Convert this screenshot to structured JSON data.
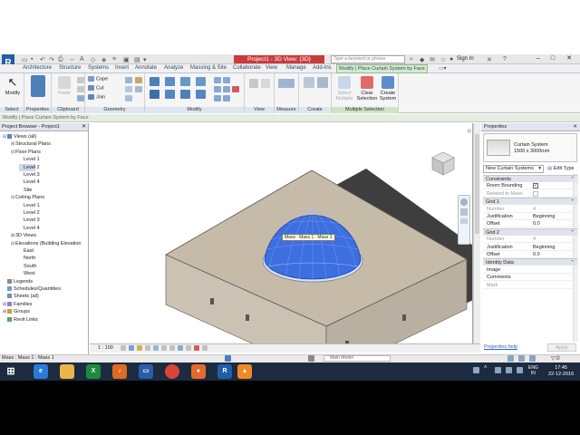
{
  "app": {
    "window_title": "Project1 - 3D View: {3D}",
    "search_placeholder": "Type a keyword or phrase",
    "sign_in": "Sign In"
  },
  "tabs": [
    "Architecture",
    "Structure",
    "Systems",
    "Insert",
    "Annotate",
    "Analyze",
    "Massing & Site",
    "Collaborate",
    "View",
    "Manage",
    "Add-Ins"
  ],
  "active_tab": "Modify | Place Curtain System by Face",
  "ribbon": {
    "panels": {
      "select": "Select",
      "properties": "Properties",
      "clipboard": "Clipboard",
      "geometry": "Geometry",
      "modify": "Modify",
      "view": "View",
      "measure": "Measure",
      "create": "Create",
      "multiple_selection": "Multiple Selection"
    },
    "buttons": {
      "modify": "Modify",
      "paste": "Paste",
      "cope": "Cope",
      "cut": "Cut",
      "join": "Join",
      "select_multiple": "Select Multiple",
      "clear_selection": "Clear Selection",
      "create_system": "Create System"
    }
  },
  "options_bar": "Modify | Place Curtain System by Face",
  "project_browser": {
    "title": "Project Browser - Project1",
    "items": [
      {
        "label": "Views (all)",
        "level": 0,
        "tog": "⊟",
        "icon": "views"
      },
      {
        "label": "Structural Plans",
        "level": 1,
        "tog": "⊞",
        "icon": ""
      },
      {
        "label": "Floor Plans",
        "level": 1,
        "tog": "⊟",
        "icon": ""
      },
      {
        "label": "Level 1",
        "level": 2,
        "tog": "",
        "icon": ""
      },
      {
        "label": "Level 2",
        "level": 2,
        "tog": "",
        "icon": "",
        "selected": true
      },
      {
        "label": "Level 3",
        "level": 2,
        "tog": "",
        "icon": ""
      },
      {
        "label": "Level 4",
        "level": 2,
        "tog": "",
        "icon": ""
      },
      {
        "label": "Site",
        "level": 2,
        "tog": "",
        "icon": ""
      },
      {
        "label": "Ceiling Plans",
        "level": 1,
        "tog": "⊟",
        "icon": ""
      },
      {
        "label": "Level 1",
        "level": 2,
        "tog": "",
        "icon": ""
      },
      {
        "label": "Level 2",
        "level": 2,
        "tog": "",
        "icon": ""
      },
      {
        "label": "Level 3",
        "level": 2,
        "tog": "",
        "icon": ""
      },
      {
        "label": "Level 4",
        "level": 2,
        "tog": "",
        "icon": ""
      },
      {
        "label": "3D Views",
        "level": 1,
        "tog": "⊞",
        "icon": ""
      },
      {
        "label": "Elevations (Building Elevation",
        "level": 1,
        "tog": "⊟",
        "icon": ""
      },
      {
        "label": "East",
        "level": 2,
        "tog": "",
        "icon": ""
      },
      {
        "label": "North",
        "level": 2,
        "tog": "",
        "icon": ""
      },
      {
        "label": "South",
        "level": 2,
        "tog": "",
        "icon": ""
      },
      {
        "label": "West",
        "level": 2,
        "tog": "",
        "icon": ""
      },
      {
        "label": "Legends",
        "level": 0,
        "tog": "",
        "icon": "legend"
      },
      {
        "label": "Schedules/Quantities",
        "level": 0,
        "tog": "",
        "icon": "schedule"
      },
      {
        "label": "Sheets (all)",
        "level": 0,
        "tog": "",
        "icon": "sheet"
      },
      {
        "label": "Families",
        "level": 0,
        "tog": "⊞",
        "icon": "family"
      },
      {
        "label": "Groups",
        "level": 0,
        "tog": "⊞",
        "icon": "group"
      },
      {
        "label": "Revit Links",
        "level": 0,
        "tog": "",
        "icon": "link"
      }
    ]
  },
  "viewport": {
    "tooltip": "Mass : Mass 1 : Mass 1",
    "scale": "1 : 100"
  },
  "properties": {
    "title": "Properties",
    "type_name_line1": "Curtain System",
    "type_name_line2": "1500 x 3000mm",
    "type_combo": "New Curtain Systems",
    "edit_type": "Edit Type",
    "groups": [
      {
        "name": "Constraints",
        "rows": [
          {
            "k": "Room Bounding",
            "v": "✓",
            "check": true
          },
          {
            "k": "Related to Mass",
            "v": "",
            "check": true,
            "dim": true
          }
        ]
      },
      {
        "name": "Grid 1",
        "rows": [
          {
            "k": "Number",
            "v": "4",
            "dim": true
          },
          {
            "k": "Justification",
            "v": "Beginning"
          },
          {
            "k": "Offset",
            "v": "0.0"
          }
        ]
      },
      {
        "name": "Grid 2",
        "rows": [
          {
            "k": "Number",
            "v": "4",
            "dim": true
          },
          {
            "k": "Justification",
            "v": "Beginning"
          },
          {
            "k": "Offset",
            "v": "0.0"
          }
        ]
      },
      {
        "name": "Identity Data",
        "rows": [
          {
            "k": "Image",
            "v": ""
          },
          {
            "k": "Comments",
            "v": ""
          },
          {
            "k": "Mark",
            "v": "",
            "dim": true
          }
        ]
      }
    ],
    "help_link": "Properties help",
    "apply": "Apply"
  },
  "status": {
    "text": "Mass : Mass 1 : Mass 1",
    "main_model": "Main Model"
  },
  "taskbar": {
    "lang_line1": "ENG",
    "lang_line2": "IN",
    "time": "17:45",
    "date": "22-12-2016"
  },
  "colors": {
    "accent_blue": "#1f5fa8",
    "contextual_tab_green": "#d6e9d1",
    "dome_blue": "#3d6fe0",
    "taskbar": "#1c2b3f"
  }
}
